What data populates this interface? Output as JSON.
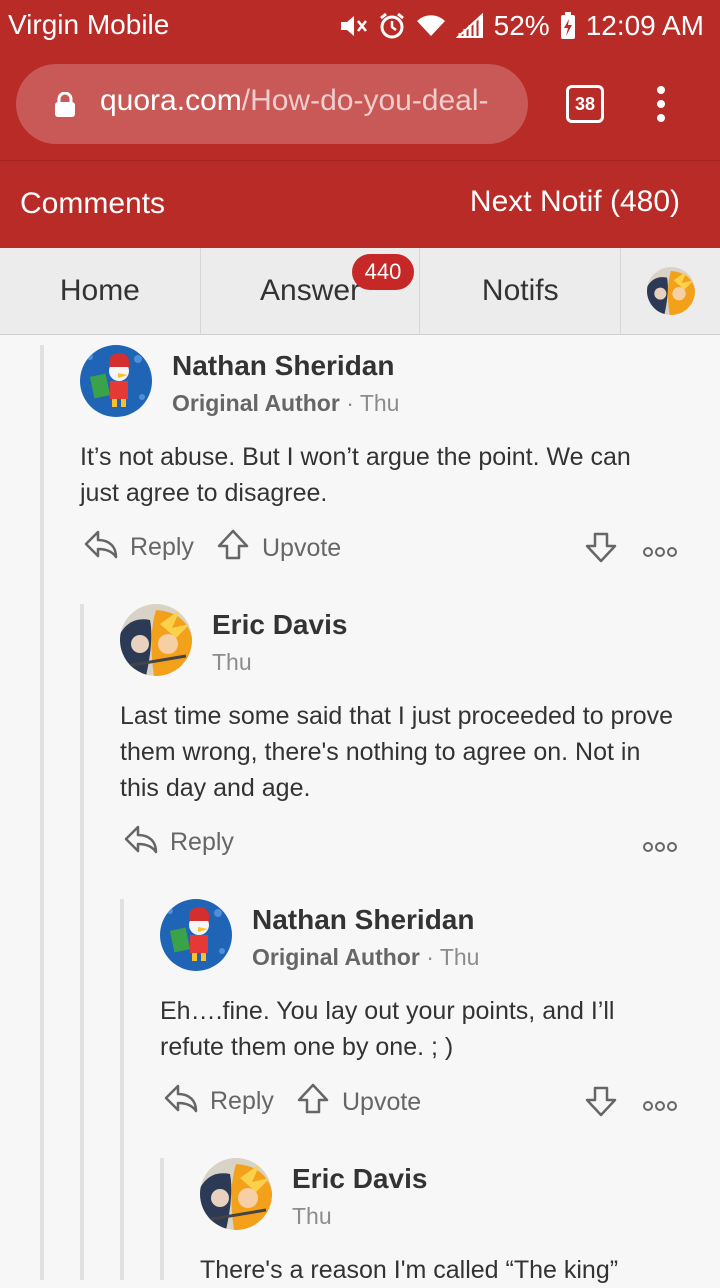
{
  "status": {
    "carrier": "Virgin Mobile",
    "battery": "52%",
    "time": "12:09 AM"
  },
  "browser": {
    "url_domain": "quora.com",
    "url_path": "/How-do-you-deal-",
    "tab_count": "38"
  },
  "subheader": {
    "left": "Comments",
    "right": "Next Notif (480)"
  },
  "nav": {
    "home": "Home",
    "answer": "Answer",
    "answer_badge": "440",
    "notifs": "Notifs"
  },
  "comments": [
    {
      "author": "Nathan Sheridan",
      "role": "Original Author",
      "time": "· Thu",
      "text": "It’s not abuse. But I won’t argue the point. We can just agree to disagree.",
      "reply_label": "Reply",
      "upvote_label": "Upvote"
    },
    {
      "author": "Eric Davis",
      "time": "Thu",
      "text": "Last time some said that I just proceeded to prove them wrong, there's nothing to agree on. Not in this day and age.",
      "reply_label": "Reply"
    },
    {
      "author": "Nathan Sheridan",
      "role": "Original Author",
      "time": "· Thu",
      "text": "Eh….fine. You lay out your points, and I’ll refute them one by one. ; )",
      "reply_label": "Reply",
      "upvote_label": "Upvote"
    },
    {
      "author": "Eric Davis",
      "time": "Thu",
      "text": "There's a reason I'm called “The king”"
    }
  ]
}
